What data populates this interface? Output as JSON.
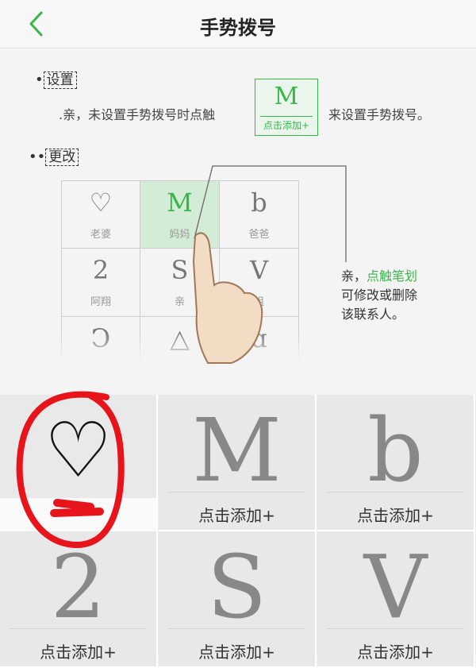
{
  "header": {
    "title": "手势拨号"
  },
  "guide": {
    "setup_label": "设置",
    "setup_text_before": ".亲，未设置手势拨号时点触",
    "setup_text_after": "来设置手势拨号。",
    "mini_button": {
      "glyph": "M",
      "label": "点击添加+"
    },
    "change_label": "更改",
    "example_cells": [
      {
        "glyph": "♡",
        "name": "老婆"
      },
      {
        "glyph": "M",
        "name": "妈妈"
      },
      {
        "glyph": "b",
        "name": "爸爸"
      },
      {
        "glyph": "2",
        "name": "阿翔"
      },
      {
        "glyph": "S",
        "name": "亲"
      },
      {
        "glyph": "V",
        "name": "姐"
      },
      {
        "glyph": "Ↄ",
        "name": ""
      },
      {
        "glyph": "△",
        "name": ""
      },
      {
        "glyph": "ɑ",
        "name": ""
      }
    ],
    "explain": {
      "prefix": "亲，",
      "highlight": "点触笔划",
      "line2": "可修改或删除",
      "line3": "该联系人。"
    }
  },
  "gesture_slots": [
    {
      "glyph": "♡",
      "label": ""
    },
    {
      "glyph": "M",
      "label": "点击添加+"
    },
    {
      "glyph": "b",
      "label": "点击添加+"
    },
    {
      "glyph": "2",
      "label": "点击添加+"
    },
    {
      "glyph": "S",
      "label": "点击添加+"
    },
    {
      "glyph": "V",
      "label": "点击添加+"
    }
  ],
  "colors": {
    "accent": "#39b54a",
    "annotation": "#e8141b"
  }
}
